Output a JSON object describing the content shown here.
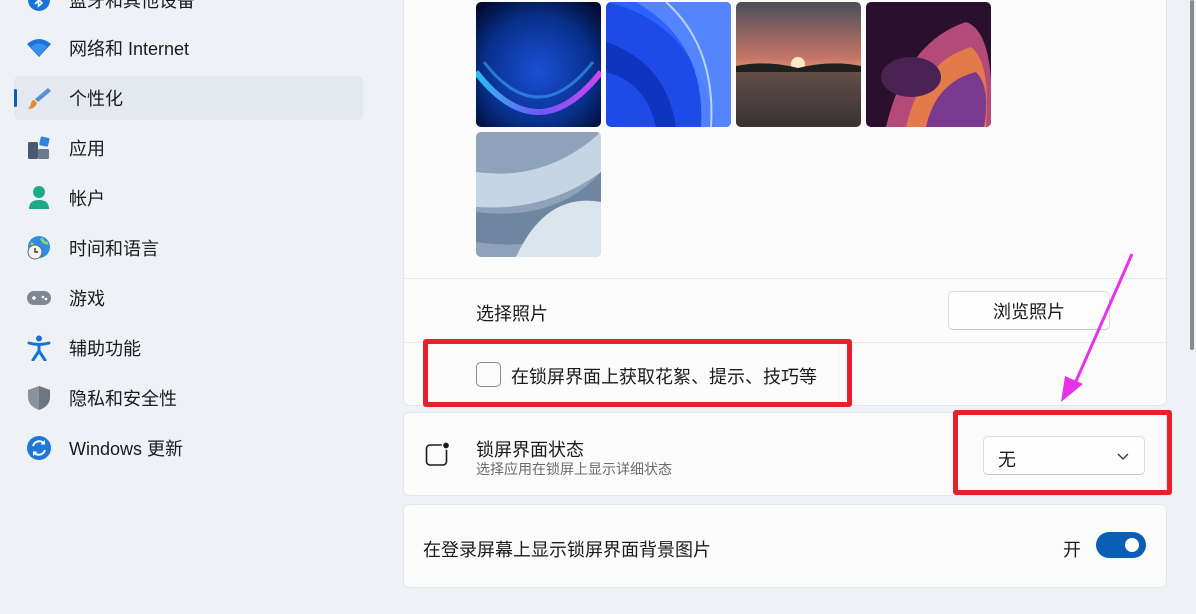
{
  "sidebar": {
    "items": [
      {
        "label": "蓝牙和其他设备",
        "icon": "bluetooth-icon"
      },
      {
        "label": "网络和 Internet",
        "icon": "wifi-icon"
      },
      {
        "label": "个性化",
        "icon": "brush-icon",
        "selected": true
      },
      {
        "label": "应用",
        "icon": "apps-icon"
      },
      {
        "label": "帐户",
        "icon": "account-icon"
      },
      {
        "label": "时间和语言",
        "icon": "globe-clock-icon"
      },
      {
        "label": "游戏",
        "icon": "gamepad-icon"
      },
      {
        "label": "辅助功能",
        "icon": "accessibility-icon"
      },
      {
        "label": "隐私和安全性",
        "icon": "shield-icon"
      },
      {
        "label": "Windows 更新",
        "icon": "update-icon"
      }
    ]
  },
  "wallpapers": [
    "bloom-blue",
    "ribbon-blue",
    "sunset-lake",
    "purple-swirl",
    "grey-flow"
  ],
  "choose_photo": {
    "label": "选择照片",
    "button": "浏览照片"
  },
  "tips_checkbox": {
    "label": "在锁屏界面上获取花絮、提示、技巧等",
    "checked": false
  },
  "lock_status": {
    "title": "锁屏界面状态",
    "subtitle": "选择应用在锁屏上显示详细状态",
    "icon": "lock-status-icon",
    "value": "无"
  },
  "signin_background": {
    "label": "在登录屏幕上显示锁屏界面背景图片",
    "state_label": "开",
    "on": true
  },
  "colors": {
    "accent": "#0a5fb5",
    "annotation_red": "#e8202a",
    "annotation_arrow": "#e733e6"
  }
}
